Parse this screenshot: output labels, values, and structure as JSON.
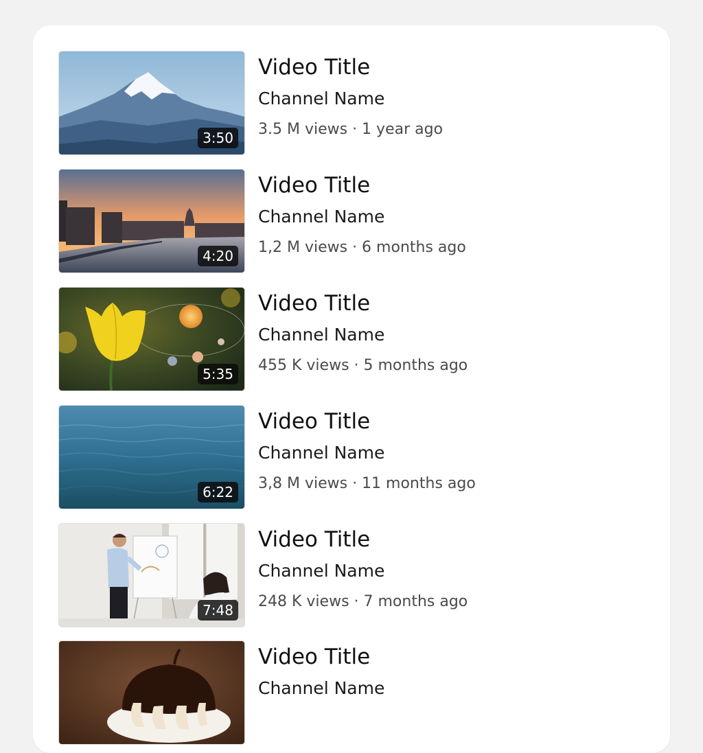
{
  "videos": [
    {
      "title": "Video Title",
      "channel": "Channel Name",
      "stats": "3.5 M views · 1 year ago",
      "duration": "3:50",
      "thumbnail": "mountain"
    },
    {
      "title": "Video Title",
      "channel": "Channel Name",
      "stats": "1,2 M views · 6 months ago",
      "duration": "4:20",
      "thumbnail": "city-sunset"
    },
    {
      "title": "Video Title",
      "channel": "Channel Name",
      "stats": "455 K views · 5 months ago",
      "duration": "5:35",
      "thumbnail": "tulip-planets"
    },
    {
      "title": "Video Title",
      "channel": "Channel Name",
      "stats": "3,8 M views · 11 months ago",
      "duration": "6:22",
      "thumbnail": "ocean"
    },
    {
      "title": "Video Title",
      "channel": "Channel Name",
      "stats": "248 K views · 7 months ago",
      "duration": "7:48",
      "thumbnail": "presentation"
    },
    {
      "title": "Video Title",
      "channel": "Channel Name",
      "thumbnail": "chocolate-dessert"
    }
  ]
}
